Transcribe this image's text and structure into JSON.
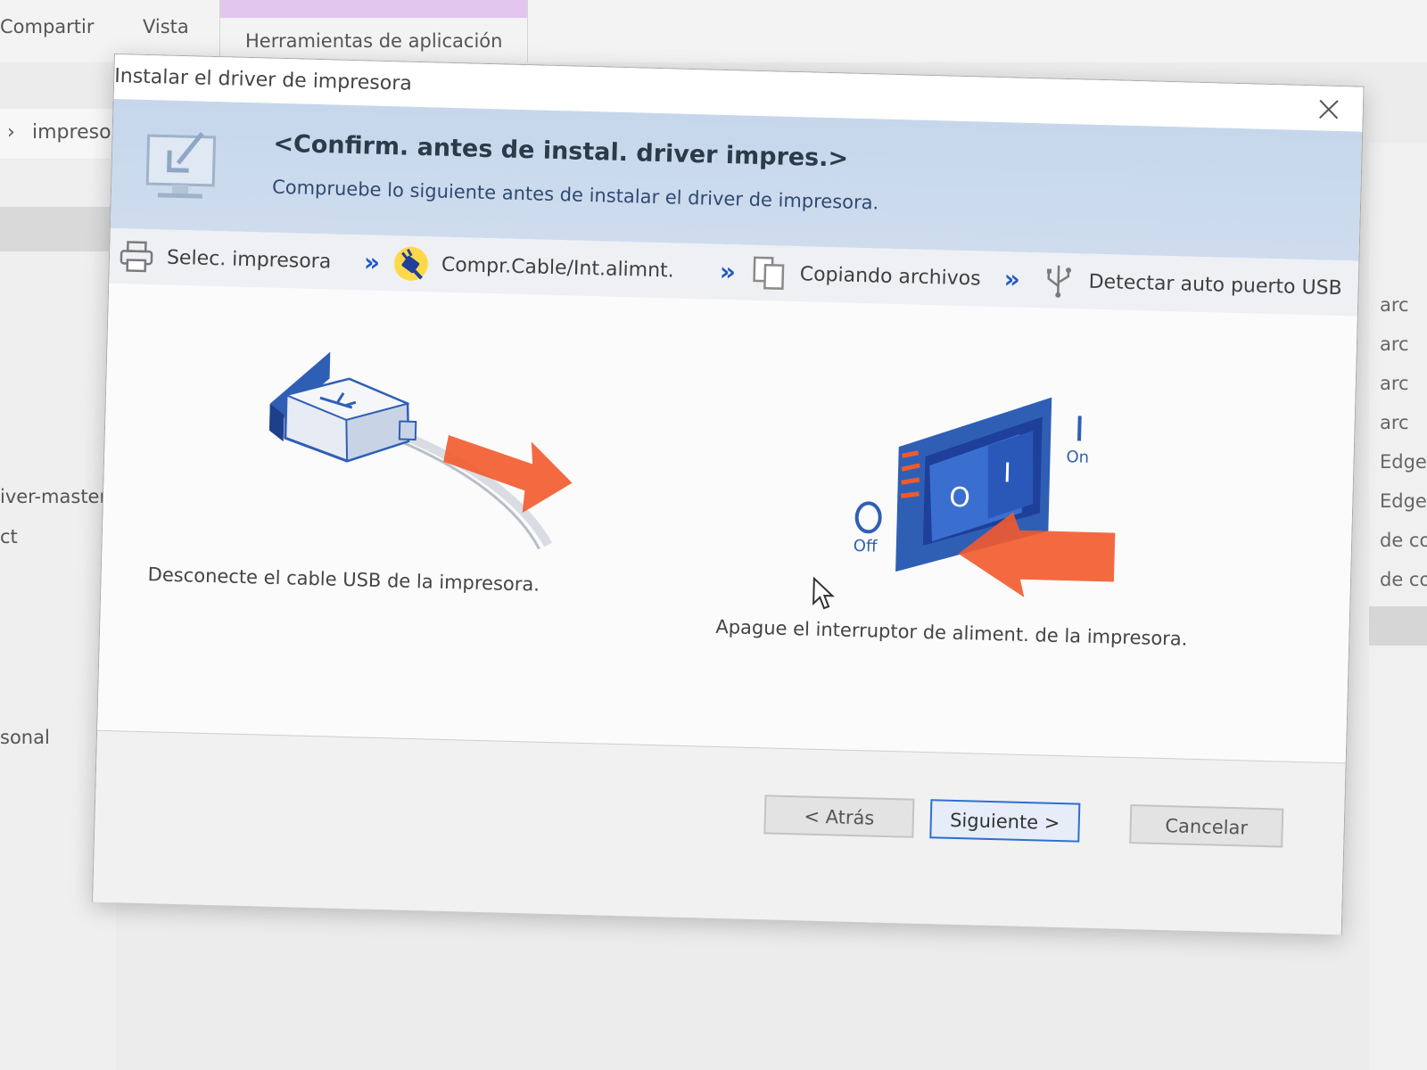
{
  "explorer": {
    "ribbon_tabs": [
      "Compartir",
      "Vista",
      "Herramientas de aplicación"
    ],
    "address_crumb": "impreso",
    "nav_items": [
      "iver-master",
      "ct",
      "sonal"
    ],
    "list_items": [
      "arc",
      "arc",
      "arc",
      "arc",
      "Edge",
      "Edge",
      "de co",
      "de co"
    ]
  },
  "dialog": {
    "title": "Instalar el driver de impresora",
    "header": {
      "title": "<Confirm. antes de instal. driver impres.>",
      "subtitle": "Compruebe lo siguiente antes de instalar el driver de impresora."
    },
    "steps": [
      {
        "label": "Selec. impresora",
        "icon": "printer-icon"
      },
      {
        "label": "Compr.Cable/Int.alimnt.",
        "icon": "plug-icon",
        "active": true
      },
      {
        "label": "Copiando archivos",
        "icon": "copy-files-icon"
      },
      {
        "label": "Detectar auto puerto USB",
        "icon": "usb-icon"
      }
    ],
    "step_separator": "»",
    "instructions": {
      "usb": "Desconecte el cable USB de la impresora.",
      "power": "Apague el interruptor de aliment. de la impresora.",
      "switch_on_label": "On",
      "switch_off_label": "Off",
      "switch_on_mark": "I",
      "switch_off_mark": "O"
    },
    "buttons": {
      "back": "< Atrás",
      "next": "Siguiente >",
      "cancel": "Cancelar"
    }
  },
  "colors": {
    "accent": "#2e6fd0",
    "header_band": "#c6d7ec",
    "arrow": "#f25a2c",
    "illustration_blue": "#2f5fb5"
  }
}
